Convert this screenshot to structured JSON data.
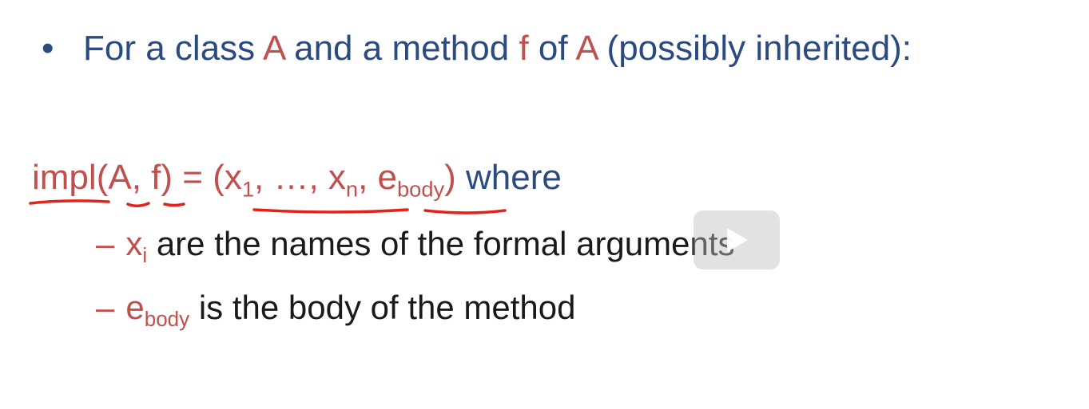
{
  "bullet": {
    "marker": "•",
    "t1": "For a class ",
    "A1": "A",
    "t2": " and a method ",
    "f": "f",
    "t3": " of ",
    "A2": "A",
    "t4": " (possibly inherited):"
  },
  "impl": {
    "impl": "impl",
    "open": "(",
    "A": "A",
    "comma1": ", ",
    "f": "f",
    "close_eq": ") = (x",
    "x_sub1": "1",
    "ellipsis": ", …, x",
    "x_subn": "n",
    "comma2": ", e",
    "e_sub": "body",
    "close": ")",
    "where": " where"
  },
  "sub1": {
    "dash": "–",
    "x": "x",
    "x_sub": "i",
    "text": " are the names of the formal arguments"
  },
  "sub2": {
    "dash": "–",
    "e": "e",
    "e_sub": "body",
    "text": " is the body of the method"
  },
  "colors": {
    "blue": "#2b4a7f",
    "red": "#c0504d",
    "black": "#1a1a1a",
    "ink": "#e8201a"
  },
  "overlay": {
    "icon": "play-icon"
  }
}
